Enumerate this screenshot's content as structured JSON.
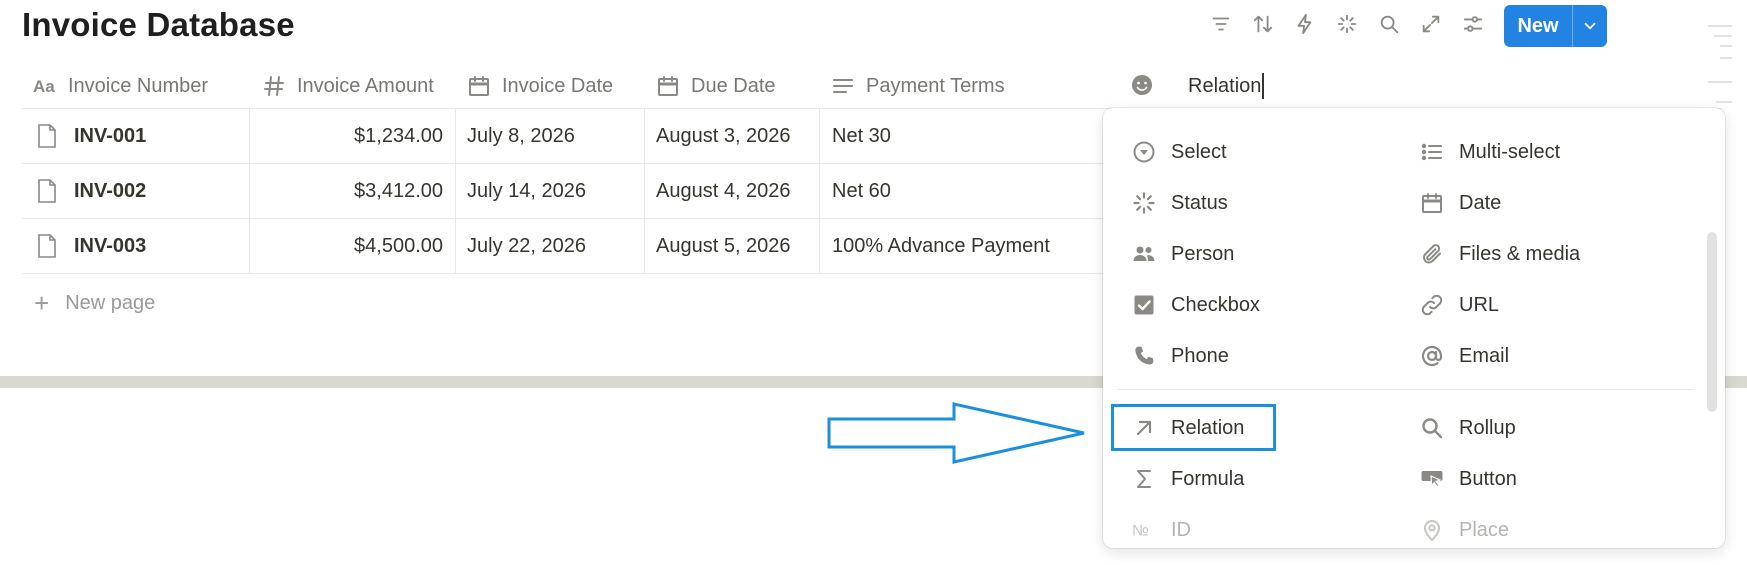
{
  "page": {
    "title": "Invoice Database"
  },
  "toolbar": {
    "icons": [
      "filter-icon",
      "sort-icon",
      "lightning-icon",
      "sparkle-icon",
      "search-icon",
      "expand-icon",
      "settings-sliders-icon"
    ],
    "new_label": "New"
  },
  "columns": [
    {
      "label": "Invoice Number",
      "icon": "text-aa-icon"
    },
    {
      "label": "Invoice Amount",
      "icon": "hash-icon"
    },
    {
      "label": "Invoice Date",
      "icon": "calendar-icon"
    },
    {
      "label": "Due Date",
      "icon": "calendar-icon"
    },
    {
      "label": "Payment Terms",
      "icon": "text-lines-icon"
    }
  ],
  "new_property": {
    "icon": "smiley-icon",
    "value": "Relation"
  },
  "rows": [
    {
      "number": "INV-001",
      "amount": "$1,234.00",
      "invoice_date": "July 8, 2026",
      "due_date": "August 3, 2026",
      "terms": "Net 30"
    },
    {
      "number": "INV-002",
      "amount": "$3,412.00",
      "invoice_date": "July 14, 2026",
      "due_date": "August 4, 2026",
      "terms": "Net 60"
    },
    {
      "number": "INV-003",
      "amount": "$4,500.00",
      "invoice_date": "July 22, 2026",
      "due_date": "August 5, 2026",
      "terms": "100% Advance Payment"
    }
  ],
  "new_page_label": "New page",
  "type_menu": {
    "options": [
      {
        "label": "Select",
        "icon": "select-icon"
      },
      {
        "label": "Multi-select",
        "icon": "list-icon"
      },
      {
        "label": "Status",
        "icon": "status-loader-icon"
      },
      {
        "label": "Date",
        "icon": "calendar-icon"
      },
      {
        "label": "Person",
        "icon": "people-icon"
      },
      {
        "label": "Files & media",
        "icon": "paperclip-icon"
      },
      {
        "label": "Checkbox",
        "icon": "checkbox-icon"
      },
      {
        "label": "URL",
        "icon": "link-icon"
      },
      {
        "label": "Phone",
        "icon": "phone-icon"
      },
      {
        "label": "Email",
        "icon": "at-icon"
      },
      {
        "label": "Relation",
        "icon": "arrow-up-right-icon"
      },
      {
        "label": "Rollup",
        "icon": "magnifier-icon"
      },
      {
        "label": "Formula",
        "icon": "sigma-icon"
      },
      {
        "label": "Button",
        "icon": "button-cursor-icon"
      },
      {
        "label": "ID",
        "icon": "numero-icon"
      },
      {
        "label": "Place",
        "icon": "location-pin-icon"
      }
    ]
  },
  "colors": {
    "accent": "#2383e2",
    "highlight": "#1b8fe0",
    "text": "#37352f",
    "muted": "#787774"
  }
}
